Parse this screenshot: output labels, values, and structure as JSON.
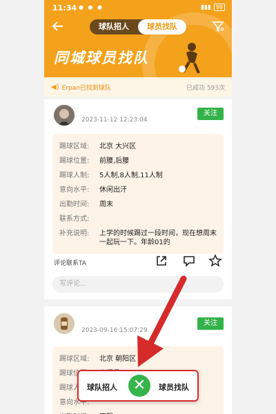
{
  "status_bar": {
    "time": "11:34",
    "battery": "99"
  },
  "header": {
    "tabs": [
      {
        "label": "球队招人"
      },
      {
        "label": "球员找队"
      }
    ],
    "banner_title": "同城球员找队"
  },
  "notice": {
    "text": "Erpan已找到球队",
    "count": "已成功 593次"
  },
  "posts": [
    {
      "timestamp": "2023-11-12 12:23:04",
      "follow_label": "关注",
      "fields": [
        {
          "key": "踢球区域:",
          "value": "北京 大兴区"
        },
        {
          "key": "踢球位置:",
          "value": "前腰,后腰"
        },
        {
          "key": "踢球人制:",
          "value": "5人制,8人制,11人制"
        },
        {
          "key": "意向水平:",
          "value": "休闲出汗"
        },
        {
          "key": "出勤时间:",
          "value": "周末"
        },
        {
          "key": "联系方式:",
          "value": ""
        },
        {
          "key": "补充说明:",
          "value": "上学的时候踢过一段时间，现在想周末一起玩一下。年龄01的"
        }
      ],
      "comment_label": "评论联系TA",
      "comment_placeholder": "写评论..."
    },
    {
      "timestamp": "2023-09-16 15:07:29",
      "follow_label": "关注",
      "fields": [
        {
          "key": "踢球区域:",
          "value": "北京 朝阳区"
        },
        {
          "key": "踢球位置:",
          "value": "守门员"
        },
        {
          "key": "踢球人制:",
          "value": ""
        },
        {
          "key": "意向水平:",
          "value": ""
        },
        {
          "key": "出勤时间:",
          "value": "不限"
        }
      ]
    }
  ],
  "popup": {
    "left_label": "球队招人",
    "right_label": "球员找队",
    "close_symbol": "✕"
  },
  "colors": {
    "accent": "#f4a21b",
    "green": "#34b24a",
    "highlight_red": "#d62b2b"
  }
}
